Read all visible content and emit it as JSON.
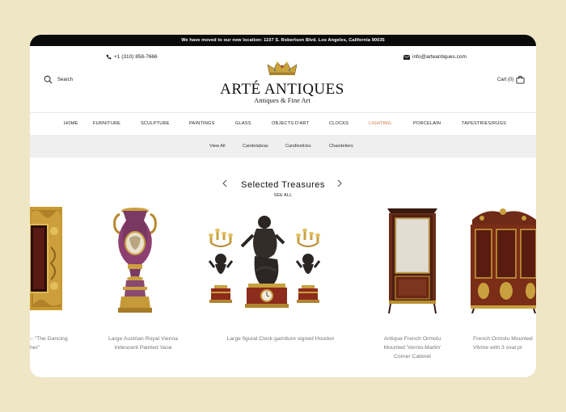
{
  "announcement": "We have moved to our new location: 1107 S. Robertson Blvd. Los Angeles, California 90035",
  "header": {
    "phone": "+1 (310) 858-7666",
    "email": "info@arteantiques.com",
    "search_label": "Search",
    "cart_label": "Cart (0)",
    "brand": "ARTÉ ANTIQUES",
    "tagline": "Antiques & Fine Art"
  },
  "nav": {
    "items": [
      "HOME",
      "FURNITURE",
      "SCULPTURE",
      "PAINTINGS",
      "GLASS",
      "OBJECTS D'ART",
      "CLOCKS",
      "LIGHTING",
      "PORCELAIN",
      "TAPESTRIES/RUGS"
    ],
    "active": "LIGHTING",
    "active_color": "#c8743a"
  },
  "subnav": {
    "items": [
      "View All",
      "Candelabras",
      "Candlesticks",
      "Chandeliers"
    ]
  },
  "section": {
    "title": "Selected Treasures",
    "see_all": "SEE ALL"
  },
  "products": [
    {
      "title_line1": "– \"The Dancing",
      "title_line2": "her\""
    },
    {
      "title_line1": "Large Austrian Royal Vienna",
      "title_line2": "Iridescent Painted Vase"
    },
    {
      "title_line1": "Large figural Clock garniture signed Houdon"
    },
    {
      "title_line1": "Antique French Ormolu",
      "title_line2": "Mounted 'Vernis-Martin'",
      "title_line3": "Corner Cabinet"
    },
    {
      "title_line1": "French Ormolu Mounted",
      "title_line2": "Vitrine with 3 oval pl"
    }
  ]
}
